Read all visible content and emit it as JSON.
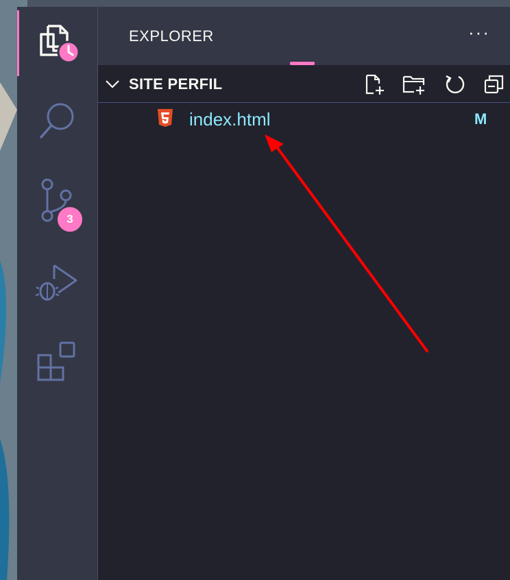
{
  "sidebar": {
    "title": "EXPLORER",
    "more_label": "···"
  },
  "activity_bar": {
    "items": [
      {
        "name": "explorer",
        "icon": "files-icon",
        "active": true
      },
      {
        "name": "search",
        "icon": "search-icon"
      },
      {
        "name": "source-control",
        "icon": "source-control-icon",
        "badge": "3"
      },
      {
        "name": "run-debug",
        "icon": "run-debug-icon"
      },
      {
        "name": "extensions",
        "icon": "extensions-icon"
      }
    ]
  },
  "section": {
    "title": "SITE PERFIL",
    "actions": [
      "new-file-icon",
      "new-folder-icon",
      "refresh-icon",
      "collapse-all-icon"
    ]
  },
  "files": [
    {
      "name": "index.html",
      "icon": "html5-icon",
      "status": "M"
    }
  ],
  "colors": {
    "accent": "#ff79c6",
    "sidebar_bg": "#21222c",
    "activity_bg": "#343746",
    "file_modified": "#8be9fd",
    "html_icon": "#e44d26",
    "annotation_arrow": "#ff0000"
  }
}
